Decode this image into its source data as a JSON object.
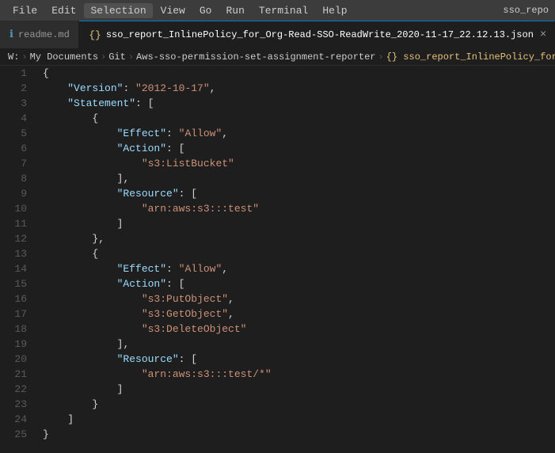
{
  "menubar": {
    "items": [
      "File",
      "Edit",
      "Selection",
      "View",
      "Go",
      "Run",
      "Terminal",
      "Help"
    ],
    "active": "Selection",
    "right_label": "sso_repo"
  },
  "tabs": [
    {
      "id": "readme",
      "icon": "ℹ",
      "icon_type": "markdown",
      "label": "readme.md",
      "active": false,
      "closable": false
    },
    {
      "id": "json",
      "icon": "{}",
      "icon_type": "json",
      "label": "sso_report_InlinePolicy_for_Org-Read-SSO-ReadWrite_2020-11-17_22.12.13.json",
      "active": true,
      "closable": true
    }
  ],
  "breadcrumb": {
    "parts": [
      "W:",
      "My Documents",
      "Git",
      "Aws-sso-permission-set-assignment-reporter",
      "{} sso_report_InlinePolicy_for_Org-Read-S"
    ]
  },
  "code": {
    "lines": [
      {
        "num": 1,
        "content": "{"
      },
      {
        "num": 2,
        "content": "    \"Version\": \"2012-10-17\","
      },
      {
        "num": 3,
        "content": "    \"Statement\": ["
      },
      {
        "num": 4,
        "content": "        {"
      },
      {
        "num": 5,
        "content": "            \"Effect\": \"Allow\","
      },
      {
        "num": 6,
        "content": "            \"Action\": ["
      },
      {
        "num": 7,
        "content": "                \"s3:ListBucket\""
      },
      {
        "num": 8,
        "content": "            ],"
      },
      {
        "num": 9,
        "content": "            \"Resource\": ["
      },
      {
        "num": 10,
        "content": "                \"arn:aws:s3:::test\""
      },
      {
        "num": 11,
        "content": "            ]"
      },
      {
        "num": 12,
        "content": "        },"
      },
      {
        "num": 13,
        "content": "        {"
      },
      {
        "num": 14,
        "content": "            \"Effect\": \"Allow\","
      },
      {
        "num": 15,
        "content": "            \"Action\": ["
      },
      {
        "num": 16,
        "content": "                \"s3:PutObject\","
      },
      {
        "num": 17,
        "content": "                \"s3:GetObject\","
      },
      {
        "num": 18,
        "content": "                \"s3:DeleteObject\""
      },
      {
        "num": 19,
        "content": "            ],"
      },
      {
        "num": 20,
        "content": "            \"Resource\": ["
      },
      {
        "num": 21,
        "content": "                \"arn:aws:s3:::test/*\""
      },
      {
        "num": 22,
        "content": "            ]"
      },
      {
        "num": 23,
        "content": "        }"
      },
      {
        "num": 24,
        "content": "    ]"
      },
      {
        "num": 25,
        "content": "}"
      }
    ]
  }
}
